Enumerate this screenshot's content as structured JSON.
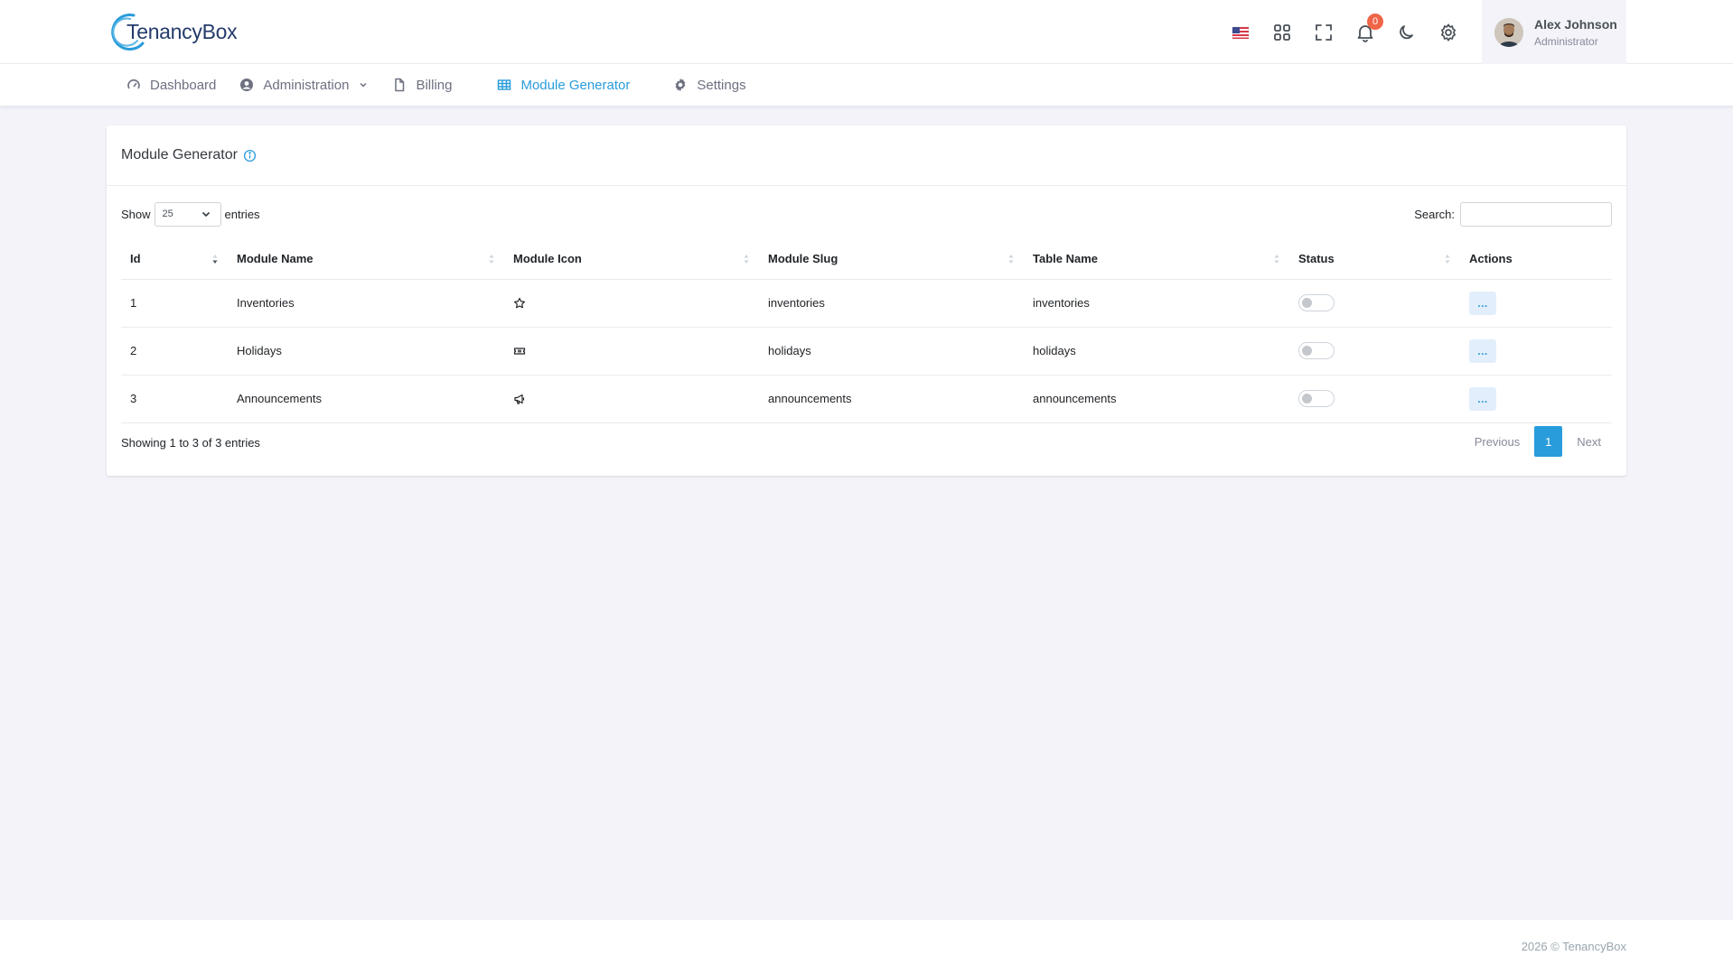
{
  "brand": {
    "name": "TenancyBox"
  },
  "header": {
    "notification_count": "0",
    "user": {
      "name": "Alex Johnson",
      "role": "Administrator"
    }
  },
  "nav": {
    "items": [
      {
        "label": "Dashboard"
      },
      {
        "label": "Administration"
      },
      {
        "label": "Billing"
      },
      {
        "label": "Module Generator"
      },
      {
        "label": "Settings"
      }
    ]
  },
  "card": {
    "title": "Module Generator",
    "show_label": "Show",
    "entries_label": "entries",
    "page_length": "25",
    "search_label": "Search:",
    "search_value": ""
  },
  "table": {
    "columns": [
      "Id",
      "Module Name",
      "Module Icon",
      "Module Slug",
      "Table Name",
      "Status",
      "Actions"
    ],
    "rows": [
      {
        "id": "1",
        "name": "Inventories",
        "icon": "star-icon",
        "slug": "inventories",
        "table": "inventories",
        "status": false,
        "action": "..."
      },
      {
        "id": "2",
        "name": "Holidays",
        "icon": "ticket-icon",
        "slug": "holidays",
        "table": "holidays",
        "status": false,
        "action": "..."
      },
      {
        "id": "3",
        "name": "Announcements",
        "icon": "megaphone-icon",
        "slug": "announcements",
        "table": "announcements",
        "status": false,
        "action": "..."
      }
    ]
  },
  "pagination": {
    "info": "Showing 1 to 3 of 3 entries",
    "previous": "Previous",
    "current": "1",
    "next": "Next"
  },
  "footer": {
    "copyright": "2026 © TenancyBox"
  },
  "colors": {
    "accent": "#299cdb",
    "badge": "#f06548",
    "body_bg": "#f3f3f9"
  }
}
